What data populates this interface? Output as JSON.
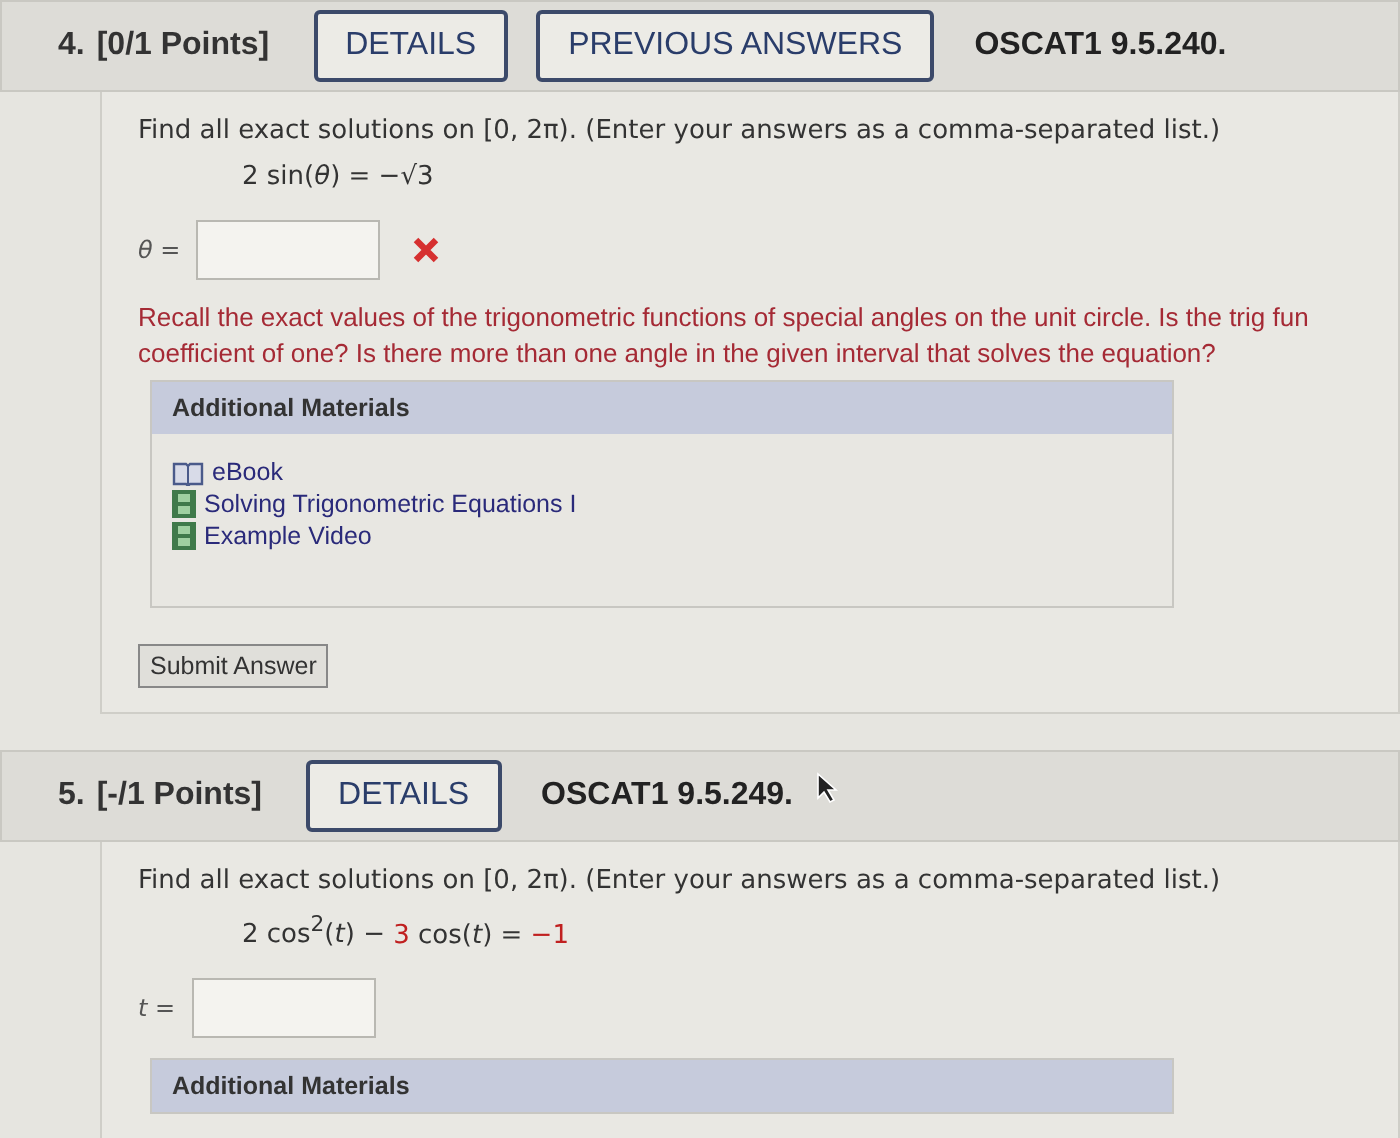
{
  "questions": [
    {
      "number": "4.",
      "points": "[0/1 Points]",
      "buttons": [
        "DETAILS",
        "PREVIOUS ANSWERS"
      ],
      "code": "OSCAT1 9.5.240.",
      "prompt": "Find all exact solutions on [0, 2π). (Enter your answers as a comma-separated list.)",
      "equation": [
        {
          "text": "2 sin(*θ*) = −√3",
          "highlight": false
        }
      ],
      "answer_label": "*θ* =",
      "incorrect": true,
      "hint": [
        "Recall the exact values of the trigonometric functions of special angles on the unit circle. Is the trig fun",
        "coefficient of one? Is there more than one angle in the given interval that solves the equation?"
      ],
      "materials": {
        "title": "Additional Materials",
        "items": [
          {
            "kind": "book",
            "label": "eBook"
          },
          {
            "kind": "video",
            "label": "Solving Trigonometric Equations I"
          },
          {
            "kind": "video",
            "label": "Example Video"
          }
        ]
      },
      "submit": "Submit Answer"
    },
    {
      "number": "5.",
      "points": "[-/1 Points]",
      "buttons": [
        "DETAILS"
      ],
      "code": "OSCAT1 9.5.249.",
      "prompt": "Find all exact solutions on [0, 2π). (Enter your answers as a comma-separated list.)",
      "equation": [
        {
          "text": "2 cos$^{2}$(*t*) − ",
          "highlight": false
        },
        {
          "text": "3",
          "highlight": true
        },
        {
          "text": " cos(*t*) = ",
          "highlight": false
        },
        {
          "text": "−1",
          "highlight": true
        }
      ],
      "answer_label": "*t* =",
      "incorrect": false,
      "materials": {
        "title": "Additional Materials"
      }
    }
  ]
}
